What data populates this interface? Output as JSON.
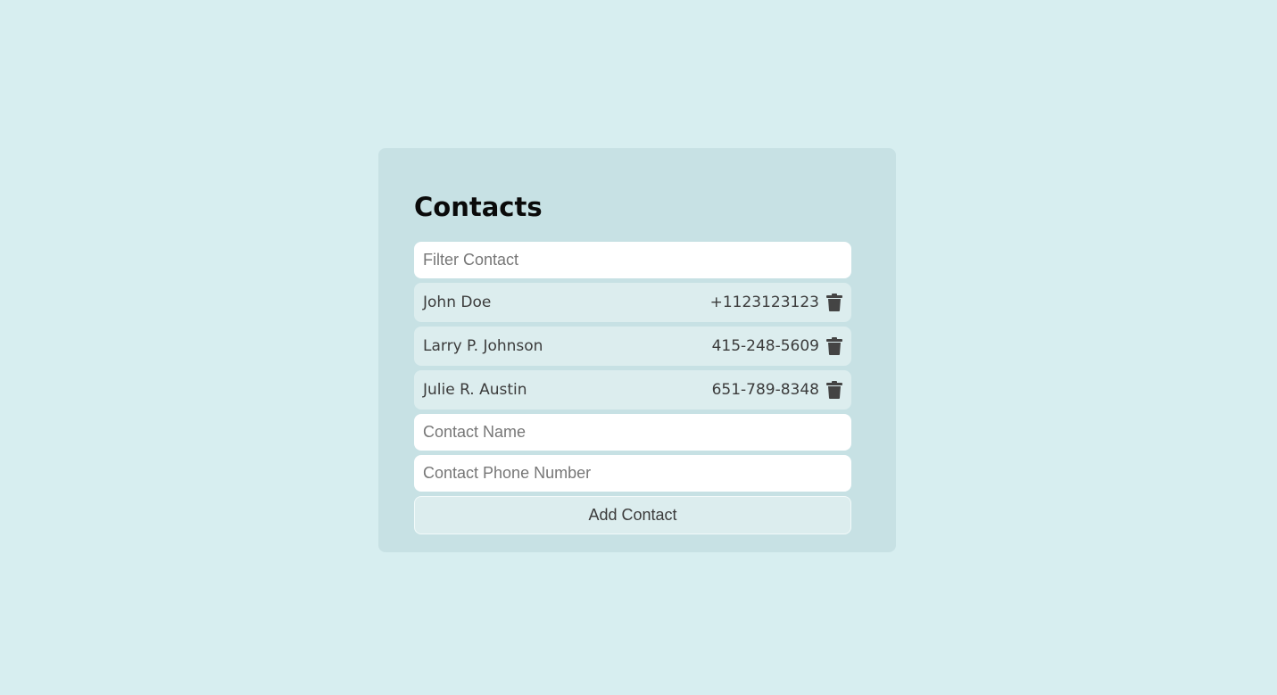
{
  "card": {
    "title": "Contacts"
  },
  "filter": {
    "placeholder": "Filter Contact"
  },
  "contacts": [
    {
      "name": "John Doe",
      "phone": "+1123123123"
    },
    {
      "name": "Larry P. Johnson",
      "phone": "415-248-5609"
    },
    {
      "name": "Julie R. Austin",
      "phone": "651-789-8348"
    }
  ],
  "form": {
    "name_placeholder": "Contact Name",
    "phone_placeholder": "Contact Phone Number",
    "add_label": "Add Contact"
  },
  "icons": {
    "delete": "trash-icon"
  },
  "colors": {
    "page_background": "#d7eef0",
    "card_background": "#c7e1e4",
    "row_background": "#dcedee",
    "text": "#3b3b3b"
  }
}
